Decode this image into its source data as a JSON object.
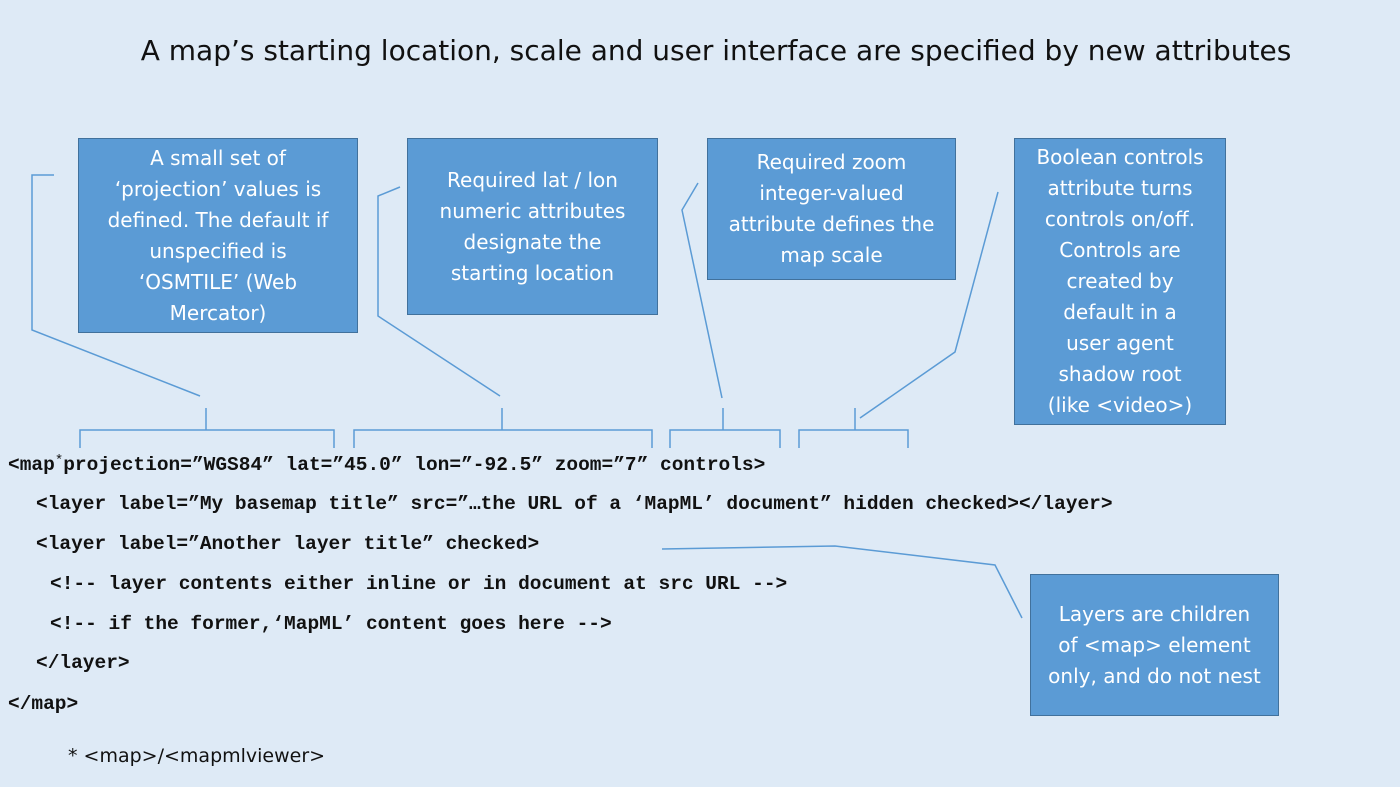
{
  "title": "A map’s starting location, scale and user interface are specified by new attributes",
  "callouts": {
    "projection": "A small set of\n‘projection’ values is\ndefined. The default if\nunspecified is\n‘OSMTILE’ (Web\nMercator)",
    "latlon": "Required lat / lon\nnumeric attributes\ndesignate the\nstarting location",
    "zoom": "Required zoom\ninteger-valued\nattribute defines the\nmap scale",
    "controls": "Boolean controls\nattribute turns\ncontrols on/off.\nControls are\ncreated by\ndefault in a\nuser agent\nshadow root\n(like <video>)",
    "layers": "Layers are children\nof <map> element\nonly, and do not nest"
  },
  "code": {
    "map_open": "<map",
    "asterisk": "*",
    "map_attrs": "projection=”WGS84” lat=”45.0” lon=”-92.5” zoom=”7” controls>",
    "layer1": "<layer label=”My basemap title” src=”…the URL of a ‘MapML’ document” hidden checked></layer>",
    "layer2": "<layer label=”Another layer title” checked>",
    "comment1": "<!-- layer contents either inline or in document at src URL -->",
    "comment2": "<!-- if the former,‘MapML’ content goes here -->",
    "layer_close": "</layer>",
    "map_close": "</map>"
  },
  "footnote": "* <map>/<mapmlviewer>",
  "colors": {
    "background": "#deeaf6",
    "callout_fill": "#5b9bd5",
    "callout_border": "#41719c",
    "connector": "#5b9bd5"
  }
}
